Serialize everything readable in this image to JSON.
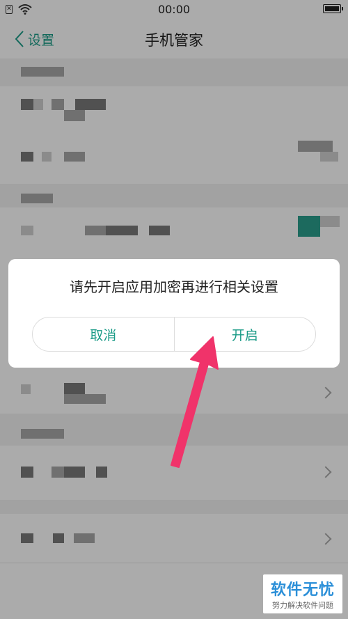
{
  "status_bar": {
    "time": "00:00"
  },
  "header": {
    "back_label": "设置",
    "title": "手机管家"
  },
  "dialog": {
    "message": "请先开启应用加密再进行相关设置",
    "cancel_label": "取消",
    "confirm_label": "开启"
  },
  "colors": {
    "accent": "#1a9b87",
    "arrow": "#f0336a",
    "watermark": "#2b8fd8"
  },
  "watermark": {
    "title": "软件无忧",
    "subtitle": "努力解决软件问题"
  }
}
